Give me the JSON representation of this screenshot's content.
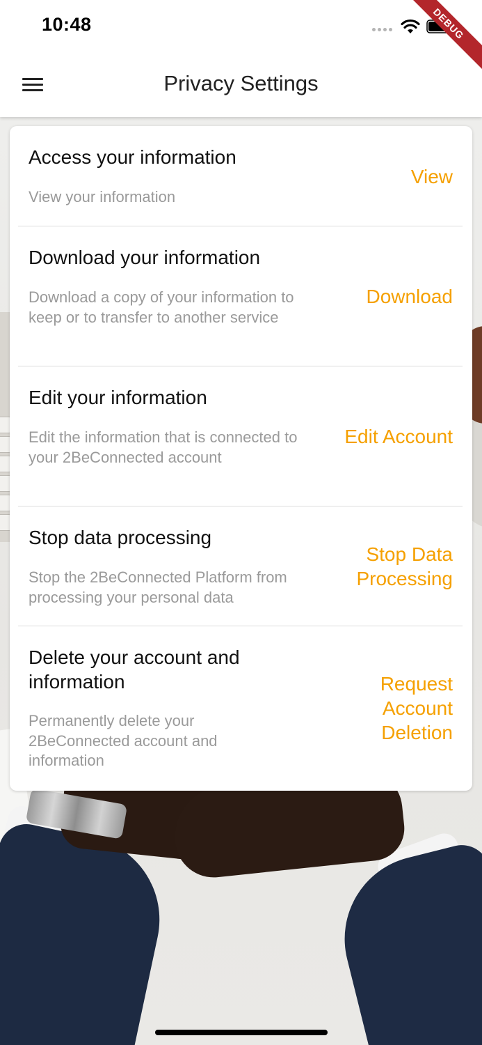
{
  "status_bar": {
    "time": "10:48",
    "debug_label": "DEBUG"
  },
  "app_bar": {
    "title": "Privacy Settings"
  },
  "colors": {
    "accent": "#f5a000",
    "title_text": "#111111",
    "desc_text": "#9a9a9a",
    "debug_banner": "#b3262b"
  },
  "icons": {
    "menu": "hamburger-menu-icon",
    "wifi": "wifi-icon",
    "battery": "battery-icon",
    "signal": "signal-icon"
  },
  "settings": [
    {
      "title": "Access your information",
      "description": "View your information",
      "action": "View"
    },
    {
      "title": "Download your information",
      "description": "Download a copy of your information to keep or to transfer to another service",
      "action": "Download"
    },
    {
      "title": "Edit your information",
      "description": "Edit the information that is connected to your 2BeConnected account",
      "action": "Edit Account"
    },
    {
      "title": "Stop data processing",
      "description": "Stop the 2BeConnected Platform from processing your personal data",
      "action": "Stop Data Processing"
    },
    {
      "title": "Delete your account and information",
      "description": "Permanently delete your 2BeConnected account and information",
      "action": "Request Account Deletion"
    }
  ]
}
